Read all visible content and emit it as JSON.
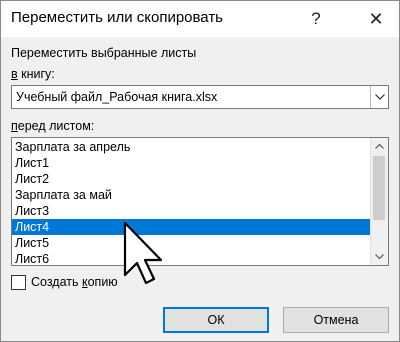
{
  "dialog": {
    "title": "Переместить или скопировать",
    "help_symbol": "?",
    "close_symbol": "✕"
  },
  "content": {
    "section_label": "Переместить выбранные листы",
    "book_label_accel": "в",
    "book_label_rest": " книгу:",
    "book_value": "Учебный файл_Рабочая книга.xlsx",
    "before_label_accel": "п",
    "before_label_rest": "еред листом:",
    "sheets": [
      {
        "label": "Зарплата за апрель",
        "selected": false
      },
      {
        "label": "Лист1",
        "selected": false
      },
      {
        "label": "Лист2",
        "selected": false
      },
      {
        "label": "Зарплата за май",
        "selected": false
      },
      {
        "label": "Лист3",
        "selected": false
      },
      {
        "label": "Лист4",
        "selected": true
      },
      {
        "label": "Лист5",
        "selected": false
      },
      {
        "label": "Лист6",
        "selected": false
      }
    ],
    "copy_label_pre": "Создать ",
    "copy_label_accel": "к",
    "copy_label_rest": "опию",
    "copy_checked": false
  },
  "buttons": {
    "ok": "ОК",
    "cancel": "Отмена"
  },
  "colors": {
    "selection": "#0078d7",
    "ok_border": "#0078d7"
  },
  "icons": {
    "combo_arrow": "chevron-down-icon",
    "scroll_up": "chevron-up-icon",
    "scroll_down": "chevron-down-icon",
    "cursor": "mouse-pointer-icon"
  }
}
